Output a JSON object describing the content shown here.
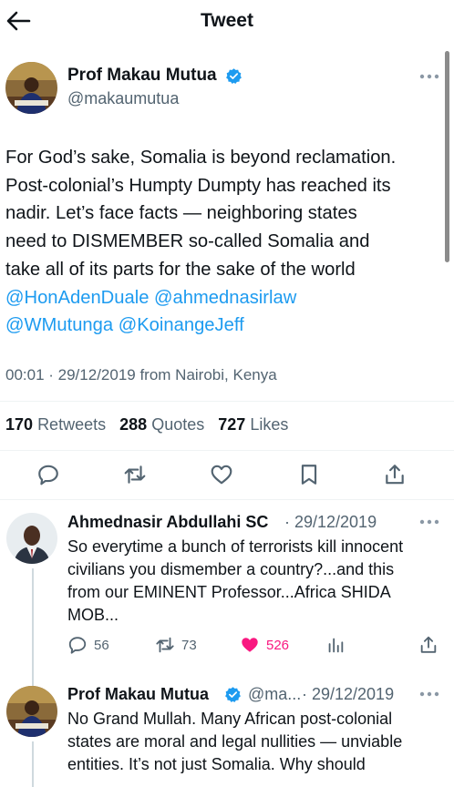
{
  "header": {
    "title": "Tweet",
    "back_icon": "arrow-left-icon"
  },
  "main_tweet": {
    "author": "Prof Makau Mutua",
    "handle": "@makaumutua",
    "verified": true,
    "text_lines": [
      "For God’s sake, Somalia is beyond reclamation.",
      "Post-colonial’s Humpty Dumpty has reached its",
      "nadir. Let’s face facts — neighboring states",
      "need to DISMEMBER so-called Somalia and",
      "take all of its parts for the sake of the world"
    ],
    "mentions": [
      "@HonAdenDuale",
      "@ahmednasirlaw",
      "@WMutunga",
      "@KoinangeJeff"
    ],
    "meta": "00:01 · 29/12/2019 from Nairobi, Kenya",
    "stats": {
      "retweets": "170",
      "retweets_label": "Retweets",
      "quotes": "288",
      "quotes_label": "Quotes",
      "likes": "727",
      "likes_label": "Likes"
    },
    "actions": [
      "reply-icon",
      "retweet-icon",
      "like-icon",
      "bookmark-icon",
      "share-icon"
    ]
  },
  "replies": [
    {
      "author": "Ahmednasir Abdullahi SC",
      "date": "· 29/12/2019",
      "text_lines": [
        "So everytime a bunch of terrorists kill innocent",
        "civilians you dismember a country?...and this",
        "from our EMINENT Professor...Africa SHIDA",
        "MOB..."
      ],
      "replies_count": "56",
      "retweets_count": "73",
      "likes_count": "526",
      "liked": true
    },
    {
      "author": "Prof Makau Mutua",
      "handle": "@ma...",
      "date": "· 29/12/2019",
      "verified": true,
      "text_lines": [
        "No Grand Mullah.  Many African post-colonial",
        "states are moral and legal nullities — unviable",
        "entities.  It’s not just Somalia.  Why should"
      ]
    }
  ],
  "colors": {
    "accent": "#1d9bf0",
    "like": "#f91880",
    "muted": "#536471",
    "text": "#0f1419"
  }
}
